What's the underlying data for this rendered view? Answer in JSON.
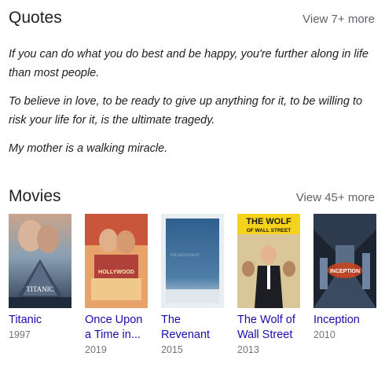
{
  "quotes": {
    "title": "Quotes",
    "view_more": "View 7+ more",
    "items": [
      "If you can do what you do best and be happy, you're further along in life than most people.",
      "To believe in love, to be ready to give up anything for it, to be willing to risk your life for it, is the ultimate tragedy.",
      "My mother is a walking miracle."
    ]
  },
  "movies": {
    "title": "Movies",
    "view_more": "View 45+ more",
    "items": [
      {
        "title": "Titanic",
        "year": "1997",
        "poster_text": "TITANIC"
      },
      {
        "title": "Once Upon a Time in...",
        "year": "2019",
        "poster_text": "HOLLYWOOD"
      },
      {
        "title": "The Revenant",
        "year": "2015",
        "poster_text": "THE REVENANT"
      },
      {
        "title": "The Wolf of Wall Street",
        "year": "2013",
        "poster_text": "THE WOLF",
        "poster_text2": "OF WALL STREET"
      },
      {
        "title": "Inception",
        "year": "2010",
        "poster_text": "INCEPTION"
      }
    ]
  },
  "colors": {
    "link": "#1a0dab",
    "secondary": "#70757a",
    "view_more": "#5f6368"
  }
}
